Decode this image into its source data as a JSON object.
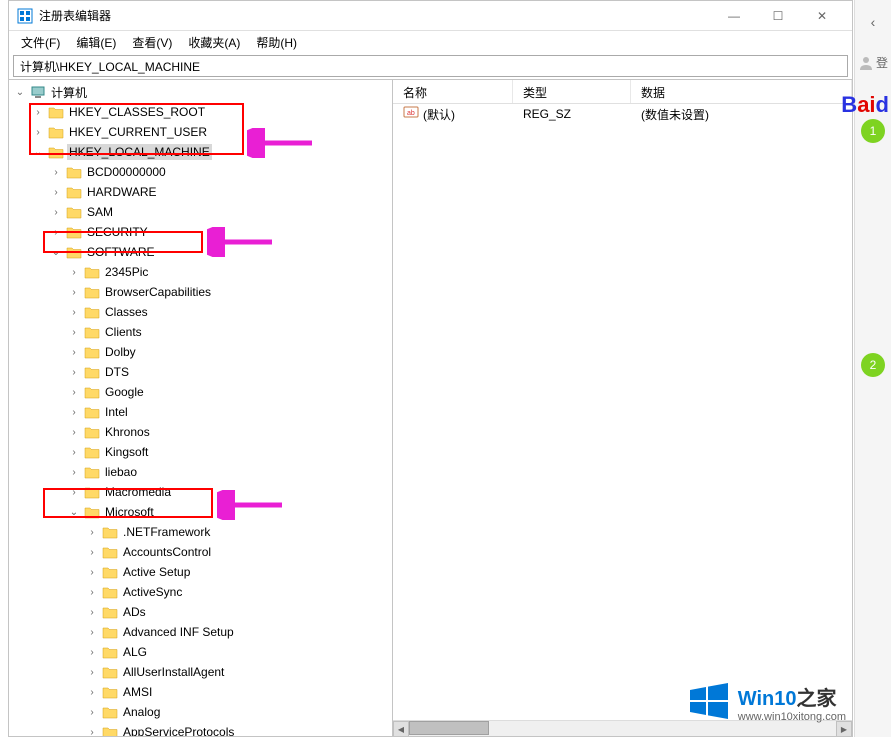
{
  "window": {
    "title": "注册表编辑器",
    "menus": [
      "文件(F)",
      "编辑(E)",
      "查看(V)",
      "收藏夹(A)",
      "帮助(H)"
    ],
    "address": "计算机\\HKEY_LOCAL_MACHINE",
    "win_buttons": {
      "min": "—",
      "max": "☐",
      "close": "✕"
    }
  },
  "tree": {
    "root": "计算机",
    "hkcr": "HKEY_CLASSES_ROOT",
    "hkcu": "HKEY_CURRENT_USER",
    "hklm": "HKEY_LOCAL_MACHINE",
    "hklm_children": [
      "BCD00000000",
      "HARDWARE",
      "SAM",
      "SECURITY",
      "SOFTWARE"
    ],
    "software_children": [
      "2345Pic",
      "BrowserCapabilities",
      "Classes",
      "Clients",
      "Dolby",
      "DTS",
      "Google",
      "Intel",
      "Khronos",
      "Kingsoft",
      "liebao",
      "Macromedia",
      "Microsoft"
    ],
    "microsoft_children": [
      ".NETFramework",
      "AccountsControl",
      "Active Setup",
      "ActiveSync",
      "ADs",
      "Advanced INF Setup",
      "ALG",
      "AllUserInstallAgent",
      "AMSI",
      "Analog",
      "AppServiceProtocols"
    ]
  },
  "list": {
    "cols": {
      "name": "名称",
      "type": "类型",
      "data": "数据"
    },
    "rows": [
      {
        "icon": "string-value-icon",
        "name": "(默认)",
        "type": "REG_SZ",
        "data": "(数值未设置)"
      }
    ]
  },
  "sidebar": {
    "login_char": "登",
    "steps": [
      "1",
      "2"
    ]
  },
  "baidu": {
    "b": "B",
    "ai": "ai",
    "du": "d"
  },
  "watermark": {
    "name_main": "Win10",
    "name_sub": "之家",
    "url": "www.win10xitong.com"
  },
  "colors": {
    "win_accent": "#0078d7",
    "highlight": "#ff0000",
    "arrow": "#e91fd4"
  }
}
